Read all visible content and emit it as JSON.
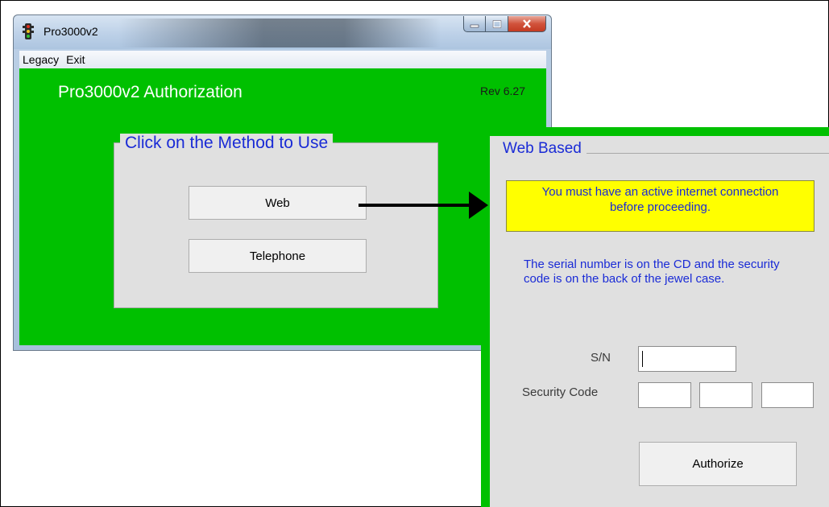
{
  "window": {
    "title": "Pro3000v2",
    "icon": "traffic-light-icon",
    "controls": {
      "minimize_icon": "minimize-icon",
      "maximize_icon": "maximize-icon",
      "close_icon": "close-icon"
    }
  },
  "menu": {
    "items": [
      "Legacy",
      "Exit"
    ]
  },
  "main": {
    "app_title": "Pro3000v2 Authorization",
    "revision": "Rev 6.27",
    "method_group": {
      "legend": "Click on the Method to Use",
      "buttons": {
        "web": "Web",
        "telephone": "Telephone"
      }
    }
  },
  "web_panel": {
    "legend": "Web Based",
    "warning": "You must have an active internet connection before proceeding.",
    "info": "The serial number is on the CD and the security code is on the back of the jewel case.",
    "sn_label": "S/N",
    "sn_value": "",
    "security_code_label": "Security Code",
    "security_code_values": [
      "",
      "",
      ""
    ],
    "authorize_button": "Authorize"
  },
  "colors": {
    "background_green": "#00c000",
    "panel_gray": "#e0e0e0",
    "label_blue": "#1a2bd6",
    "warning_yellow": "#ffff00"
  }
}
